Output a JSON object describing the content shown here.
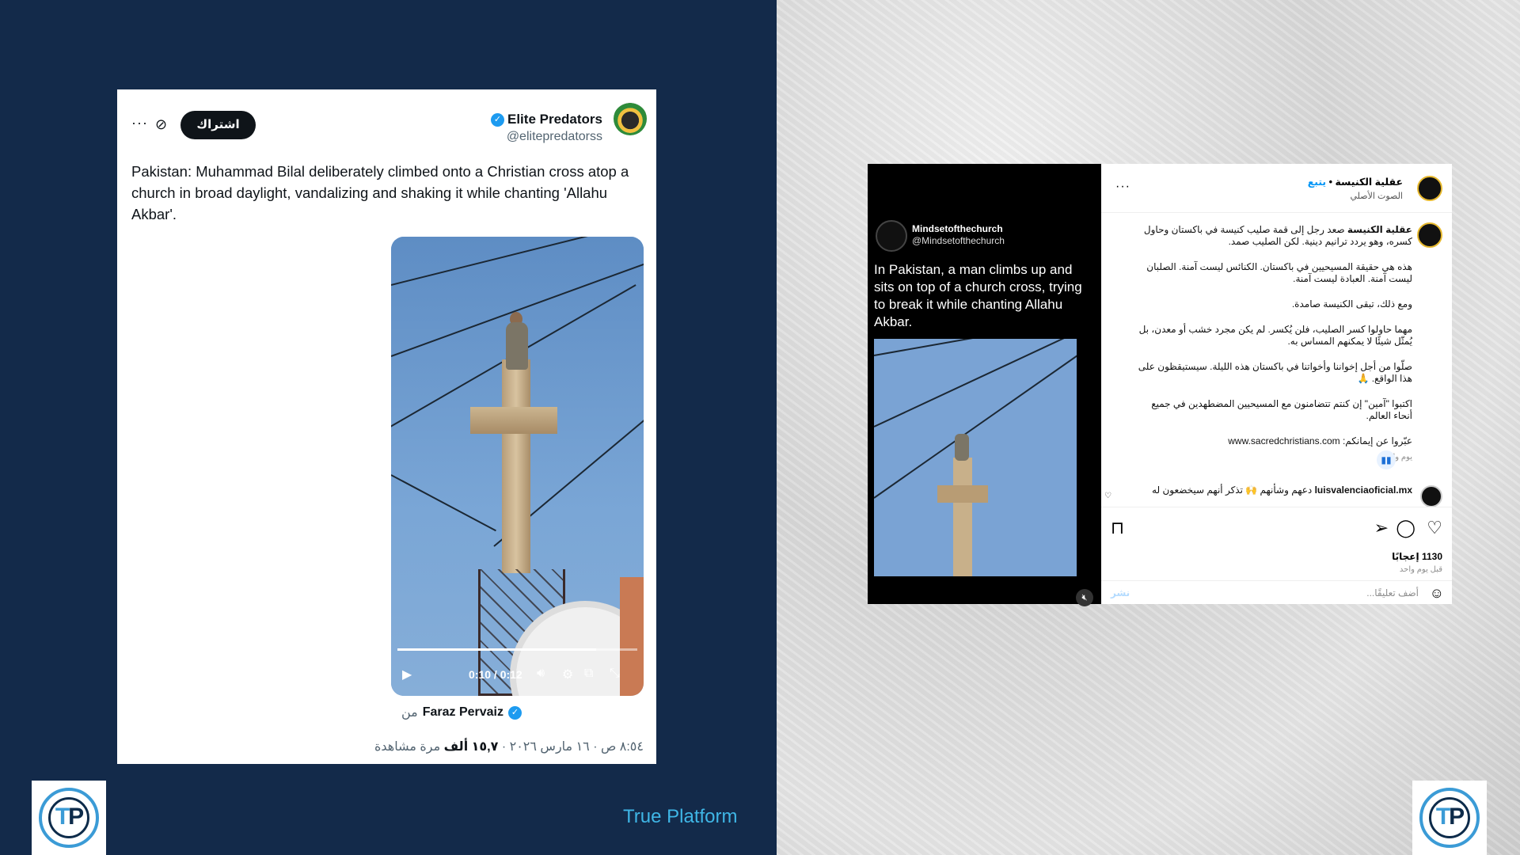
{
  "brand": {
    "label": "True Platform",
    "logo_letters": [
      "T",
      "P"
    ],
    "accent": "#3fb6e6",
    "navy": "#132a4a"
  },
  "tweet": {
    "display_name": "Elite Predators",
    "handle": "@elitepredatorss",
    "subscribe_label": "اشتراك",
    "more_icon": "ellipsis-icon",
    "grok_icon": "grok-icon",
    "text": "Pakistan: Muhammad Bilal deliberately climbed onto a Christian cross atop a church in broad daylight, vandalizing and shaking it while chanting 'Allahu Akbar'.",
    "video": {
      "time": "0:10 / 0:12",
      "progress": 0.83
    },
    "from_label": "من",
    "from_name": "Faraz Pervaiz",
    "timestamp": "٨:٥٤ ص · ١٦ مارس ٢٠٢٦ · ",
    "views_count": "١٥,٧ ألف",
    "views_label": " مرة مشاهدة"
  },
  "instagram": {
    "media": {
      "account_name": "Mindsetofthechurch",
      "account_handle": "@Mindsetofthechurch",
      "text": "In Pakistan, a man climbs up and sits on top of a church cross, trying to break it while chanting Allahu Akbar."
    },
    "header": {
      "username": "عقلية الكنيسة",
      "separator": " • ",
      "follow_label": "يتبع",
      "audio_label": "الصوت الأصلي"
    },
    "caption": {
      "username": "عقلية الكنيسة",
      "intro": " صعد رجل إلى قمة صليب كنيسة في باكستان وحاول كسره، وهو يردد ترانيم دينية. لكن الصليب صمد.",
      "p2": "هذه هي حقيقة المسيحيين في باكستان. الكنائس ليست آمنة. الصلبان ليست آمنة. العبادة ليست آمنة.",
      "p3": "ومع ذلك، تبقى الكنيسة صامدة.",
      "p4": "مهما حاولوا كسر الصليب، فلن يُكسر. لم يكن مجرد خشب أو معدن، بل يُمثّل شيئًا لا يمكنهم المساس به.",
      "p5": "صلّوا من أجل إخواننا وأخواتنا في باكستان هذه الليلة. سيستيقظون على هذا الواقع. 🙏",
      "p6": "اكتبوا \"آمين\" إن كنتم تتضامنون مع المسيحيين المضطهدين في جميع أنحاء العالم.",
      "link_label": "عبّروا عن إيمانكم: ",
      "link": "www.sacredchristians.com",
      "time": "يوم واحد"
    },
    "comment": {
      "username": "luisvalenciaoficial.mx",
      "text": " دعهم وشأنهم 🙌 تذكر أنهم سيخضعون له"
    },
    "likes": "1130 إعجابًا",
    "posted_ago": "قبل يوم واحد",
    "add_comment_placeholder": "أضف تعليقًا...",
    "post_label": "نشر"
  }
}
